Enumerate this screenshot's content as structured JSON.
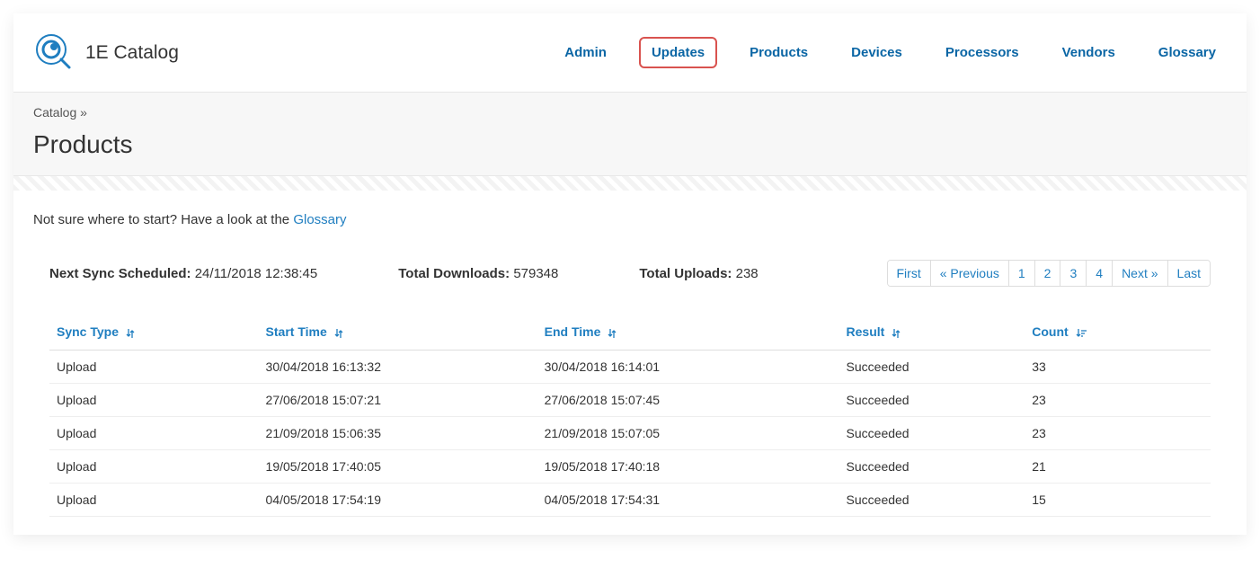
{
  "brand": {
    "title": "1E Catalog"
  },
  "nav": {
    "items": [
      {
        "label": "Admin",
        "active": false
      },
      {
        "label": "Updates",
        "active": true
      },
      {
        "label": "Products",
        "active": false
      },
      {
        "label": "Devices",
        "active": false
      },
      {
        "label": "Processors",
        "active": false
      },
      {
        "label": "Vendors",
        "active": false
      },
      {
        "label": "Glossary",
        "active": false
      }
    ]
  },
  "breadcrumb": "Catalog »",
  "page_title": "Products",
  "info_bar": {
    "prefix": "Not sure where to start? Have a look at the ",
    "link": "Glossary"
  },
  "stats": {
    "next_sync_label": "Next Sync Scheduled:",
    "next_sync_value": "24/11/2018 12:38:45",
    "total_downloads_label": "Total Downloads:",
    "total_downloads_value": "579348",
    "total_uploads_label": "Total Uploads:",
    "total_uploads_value": "238"
  },
  "pagination": {
    "items": [
      "First",
      "« Previous",
      "1",
      "2",
      "3",
      "4",
      "Next »",
      "Last"
    ]
  },
  "table": {
    "headers": [
      {
        "label": "Sync Type",
        "sort": "↓↑"
      },
      {
        "label": "Start Time",
        "sort": "↓↑"
      },
      {
        "label": "End Time",
        "sort": "↓↑"
      },
      {
        "label": "Result",
        "sort": "↓↑"
      },
      {
        "label": "Count",
        "sort": "↓₹"
      }
    ],
    "rows": [
      {
        "sync_type": "Upload",
        "start": "30/04/2018 16:13:32",
        "end": "30/04/2018 16:14:01",
        "result": "Succeeded",
        "count": "33"
      },
      {
        "sync_type": "Upload",
        "start": "27/06/2018 15:07:21",
        "end": "27/06/2018 15:07:45",
        "result": "Succeeded",
        "count": "23"
      },
      {
        "sync_type": "Upload",
        "start": "21/09/2018 15:06:35",
        "end": "21/09/2018 15:07:05",
        "result": "Succeeded",
        "count": "23"
      },
      {
        "sync_type": "Upload",
        "start": "19/05/2018 17:40:05",
        "end": "19/05/2018 17:40:18",
        "result": "Succeeded",
        "count": "21"
      },
      {
        "sync_type": "Upload",
        "start": "04/05/2018 17:54:19",
        "end": "04/05/2018 17:54:31",
        "result": "Succeeded",
        "count": "15"
      }
    ]
  }
}
